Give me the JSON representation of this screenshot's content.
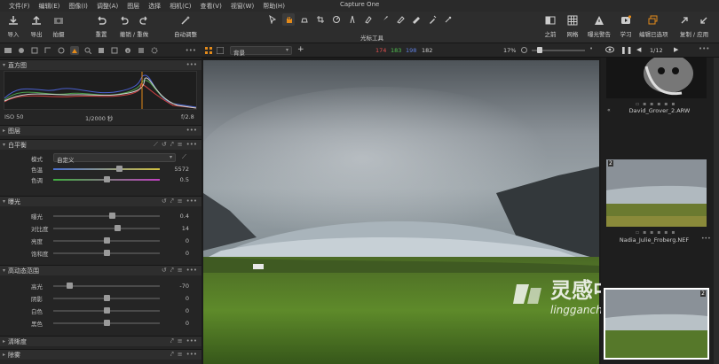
{
  "app": {
    "title": "Capture One"
  },
  "menu": [
    "文件(F)",
    "编辑(E)",
    "图像(I)",
    "调整(A)",
    "图层",
    "选择",
    "相机(C)",
    "查看(V)",
    "视窗(W)",
    "帮助(H)"
  ],
  "toolbar": {
    "import": "导入",
    "export": "导出",
    "capture": "拍摄",
    "reset": "重置",
    "undo_redo": "撤销 / 重做",
    "auto_adjust": "自动调整",
    "cursor_tools_label": "光标工具",
    "before": "之前",
    "grid": "网格",
    "exposure_warning": "曝光警告",
    "learn": "学习",
    "edit_options": "编辑已选项",
    "copy_apply": "复制 / 应用"
  },
  "histogram": {
    "iso": "ISO 50",
    "shutter": "1/2000 秒",
    "aperture": "f/2.8"
  },
  "panels": {
    "histogram_title": "直方图",
    "layers_title": "图层",
    "white_balance": {
      "title": "白平衡",
      "mode_label": "模式",
      "mode_value": "自定义",
      "temp_label": "色温",
      "temp_value": "5572",
      "temp_pos": 0.62,
      "tint_label": "色调",
      "tint_value": "0.5",
      "tint_pos": 0.5
    },
    "exposure": {
      "title": "曝光",
      "rows": [
        {
          "label": "曝光",
          "value": "0.4",
          "pos": 0.55
        },
        {
          "label": "对比度",
          "value": "14",
          "pos": 0.6
        },
        {
          "label": "亮度",
          "value": "0",
          "pos": 0.5
        },
        {
          "label": "饱和度",
          "value": "0",
          "pos": 0.5
        }
      ]
    },
    "hdr": {
      "title": "高动态范围",
      "rows": [
        {
          "label": "高光",
          "value": "-70",
          "pos": 0.15
        },
        {
          "label": "阴影",
          "value": "0",
          "pos": 0.5
        },
        {
          "label": "白色",
          "value": "0",
          "pos": 0.5
        },
        {
          "label": "黑色",
          "value": "0",
          "pos": 0.5
        }
      ]
    },
    "clarity_title": "清晰度",
    "dehaze_title": "除雾"
  },
  "viewer": {
    "background_label": "背景",
    "rgb": {
      "r": "174",
      "g": "183",
      "b": "198",
      "l": "182"
    },
    "zoom": "17%",
    "zoom_pos": 0.1
  },
  "browser": {
    "count": "1/12",
    "thumbs": [
      {
        "name": "David_Grover_2.ARW"
      },
      {
        "name": "Nadia_Julie_Froberg.NEF",
        "badge": "2"
      },
      {
        "badge": "2"
      }
    ]
  },
  "watermark": {
    "title": "灵感中国",
    "subtitle": "lingganchina.com"
  },
  "colors": {
    "accent": "#e38a1a",
    "hist_red": "#d04040",
    "hist_green": "#4aa04a",
    "hist_blue": "#4a60d0",
    "selected_border": "#ffffff"
  }
}
